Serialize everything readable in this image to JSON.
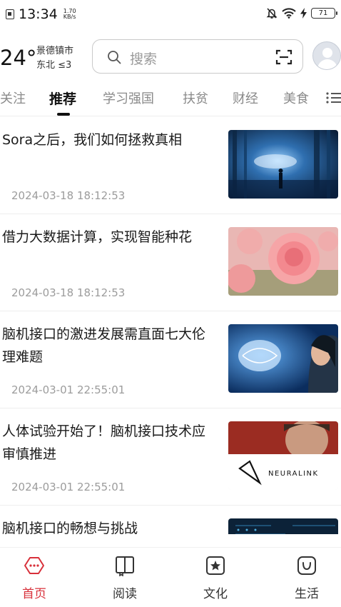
{
  "status_bar": {
    "time": "13:34",
    "net_speed_value": "1.70",
    "net_speed_unit": "KB/s",
    "battery": "71",
    "icons": [
      "sim-icon",
      "mute-bell-icon",
      "wifi-icon",
      "charging-icon",
      "battery-icon"
    ]
  },
  "header": {
    "temperature": "24°",
    "city": "景德镇市",
    "wind": "东北 ≤3",
    "search_placeholder": "搜索"
  },
  "tabs": [
    {
      "label": "关注",
      "active": false
    },
    {
      "label": "推荐",
      "active": true
    },
    {
      "label": "学习强国",
      "active": false
    },
    {
      "label": "扶贫",
      "active": false
    },
    {
      "label": "财经",
      "active": false
    },
    {
      "label": "美食",
      "active": false
    }
  ],
  "news": [
    {
      "title": "Sora之后，我们如何拯救真相",
      "date": "2024-03-18 18:12:53",
      "thumb": "sci-fi-corridor-image"
    },
    {
      "title": "借力大数据计算，实现智能种花",
      "date": "2024-03-18 18:12:53",
      "thumb": "pink-rose-image"
    },
    {
      "title": "脑机接口的激进发展需直面七大伦理难题",
      "date": "2024-03-01 22:55:01",
      "thumb": "digital-brain-image"
    },
    {
      "title": "人体试验开始了！脑机接口技术应审慎推进",
      "date": "2024-03-01 22:55:01",
      "thumb": "neuralink-image",
      "thumb_text": "NEURALINK"
    },
    {
      "title": "脑机接口的畅想与挑战",
      "date": "",
      "thumb": "circuit-image"
    }
  ],
  "bottom_nav": [
    {
      "label": "首页",
      "icon": "home-icon",
      "active": true
    },
    {
      "label": "阅读",
      "icon": "book-icon",
      "active": false
    },
    {
      "label": "文化",
      "icon": "culture-star-icon",
      "active": false
    },
    {
      "label": "生活",
      "icon": "life-bag-icon",
      "active": false
    }
  ],
  "colors": {
    "accent": "#d8303a",
    "text": "#1a1a1a",
    "muted": "#9c9c9c"
  }
}
